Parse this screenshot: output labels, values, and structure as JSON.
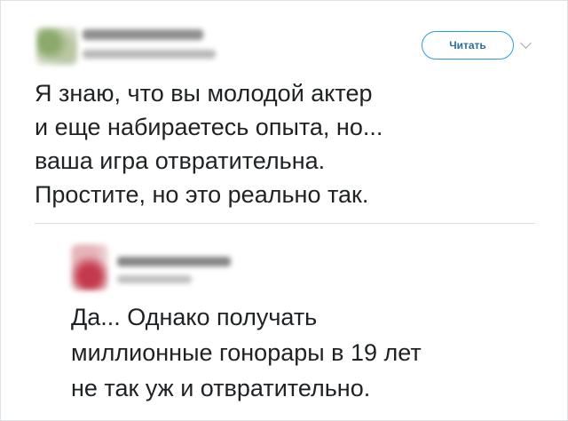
{
  "tweet": {
    "follow_label": "Читать",
    "text": "Я знаю, что вы молодой актер\nи еще набираетесь опыта, но...\nваша игра отвратительна.\nПростите, но это реально так."
  },
  "reply": {
    "text": "Да... Однако получать\nмиллионные гонорары в 19 лет\nне так уж и отвратительно."
  }
}
